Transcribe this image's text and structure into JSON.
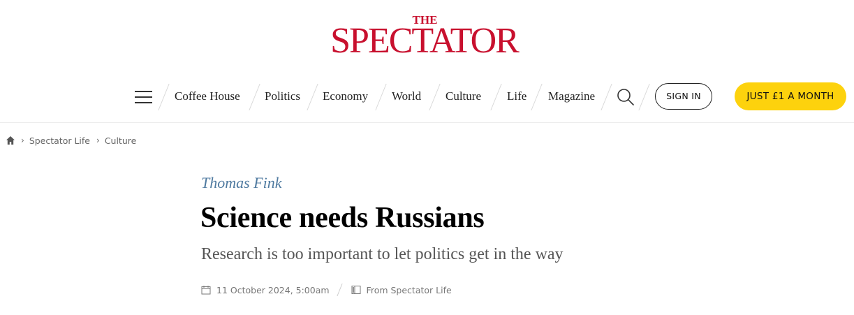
{
  "brand": {
    "the": "THE",
    "name": "SPECTATOR",
    "color": "#c8102e"
  },
  "nav": {
    "menu_icon": "hamburger-menu-icon",
    "items": [
      "Coffee House",
      "Politics",
      "Economy",
      "World",
      "Culture",
      "Life",
      "Magazine"
    ],
    "search_icon": "search-icon",
    "sign_in": "SIGN IN",
    "subscribe": "JUST £1 A MONTH",
    "subscribe_color": "#fdd20d"
  },
  "breadcrumb": {
    "home_icon": "home-icon",
    "items": [
      "Spectator Life",
      "Culture"
    ]
  },
  "article": {
    "author": "Thomas Fink",
    "author_color": "#4f7aa0",
    "title": "Science needs Russians",
    "standfirst": "Research is too important to let politics get in the way",
    "date": "11 October 2024, 5:00am",
    "date_icon": "calendar-icon",
    "source": "From Spectator Life",
    "source_icon": "book-icon"
  }
}
